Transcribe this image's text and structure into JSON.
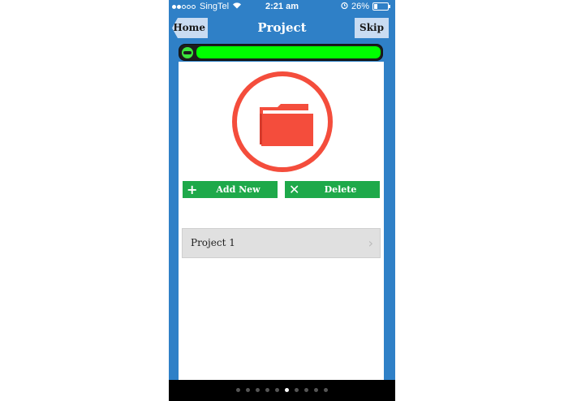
{
  "status_bar": {
    "carrier": "SingTel",
    "time": "2:21 am",
    "battery": "26%",
    "signal_icon": "signal-dots-icon",
    "wifi_icon": "wifi-icon",
    "alarm_icon": "alarm-icon",
    "battery_icon": "battery-icon"
  },
  "nav": {
    "home_label": "Home",
    "title": "Project",
    "skip_label": "Skip"
  },
  "progress": {
    "value": 1.0,
    "fill_color": "#00ff00",
    "icon": "progress-face-icon"
  },
  "hero": {
    "icon": "folder-icon",
    "color": "#f44d3c"
  },
  "actions": {
    "add_label": "Add New",
    "add_icon": "plus-icon",
    "delete_label": "Delete",
    "delete_icon": "x-icon",
    "color": "#1ea94a"
  },
  "projects": [
    {
      "name": "Project 1"
    }
  ],
  "pager": {
    "count": 10,
    "active_index": 5
  },
  "colors": {
    "brand_blue": "#2f80c7",
    "nav_button_bg": "#c9dcf2"
  }
}
